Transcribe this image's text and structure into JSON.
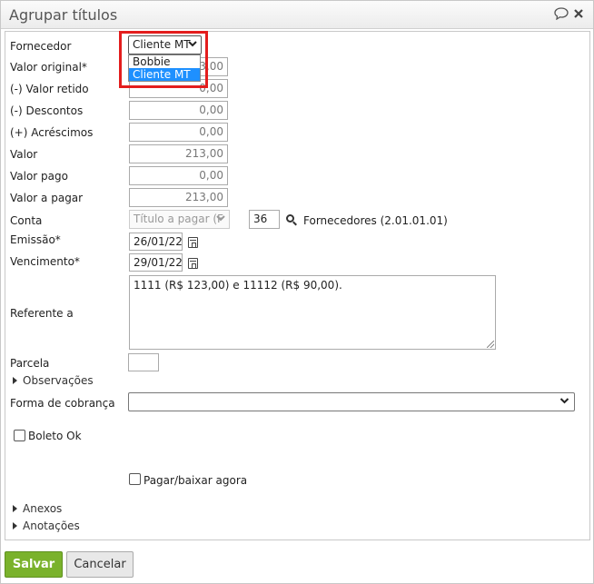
{
  "dialog": {
    "title": "Agrupar títulos",
    "chat_icon": "speech-bubble-icon",
    "close_icon": "close-icon"
  },
  "form": {
    "fornecedor": {
      "label": "Fornecedor",
      "selected": "Cliente MT",
      "options": [
        "Bobbie",
        "Cliente MT"
      ]
    },
    "valor_original": {
      "label": "Valor original*",
      "value": "213,00"
    },
    "valor_retido": {
      "label": "(-) Valor retido",
      "value": "0,00"
    },
    "descontos": {
      "label": "(-) Descontos",
      "value": "0,00"
    },
    "acrescimos": {
      "label": "(+) Acréscimos",
      "value": "0,00"
    },
    "valor": {
      "label": "Valor",
      "value": "213,00"
    },
    "valor_pago": {
      "label": "Valor pago",
      "value": "0,00"
    },
    "valor_a_pagar": {
      "label": "Valor a pagar",
      "value": "213,00"
    },
    "conta": {
      "label": "Conta",
      "select_value": "Título a pagar (F",
      "code": "36",
      "description": "Fornecedores (2.01.01.01)"
    },
    "emissao": {
      "label": "Emissão*",
      "value": "26/01/22"
    },
    "vencimento": {
      "label": "Vencimento*",
      "value": "29/01/22"
    },
    "referente": {
      "label": "Referente a",
      "value": "1111 (R$ 123,00) e 11112 (R$ 90,00)."
    },
    "parcela": {
      "label": "Parcela",
      "value": ""
    },
    "observacoes": {
      "label": "Observações"
    },
    "forma_cobranca": {
      "label": "Forma de cobrança",
      "value": ""
    },
    "boleto_ok": {
      "label": "Boleto Ok"
    },
    "pagar_agora": {
      "label": "Pagar/baixar agora"
    },
    "anexos": {
      "label": "Anexos"
    },
    "anotacoes": {
      "label": "Anotações"
    }
  },
  "buttons": {
    "save": "Salvar",
    "cancel": "Cancelar"
  },
  "colors": {
    "save_button": "#7ab22c",
    "highlight": "#e31d1d",
    "dropdown_selected": "#1e90ff"
  }
}
